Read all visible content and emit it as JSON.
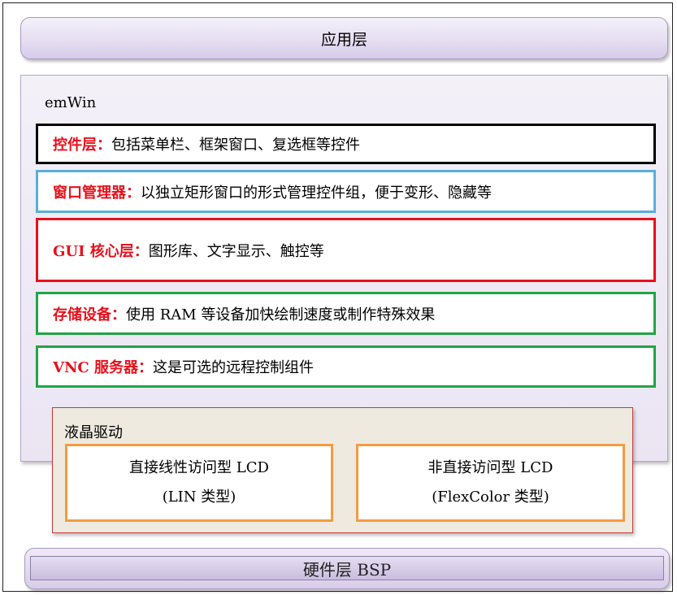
{
  "app_layer": {
    "label": "应用层"
  },
  "emwin": {
    "title": "emWin",
    "layers": [
      {
        "key": "控件层：",
        "desc": "包括菜单栏、框架窗口、复选框等控件"
      },
      {
        "key": "窗口管理器：",
        "desc": "以独立矩形窗口的形式管理控件组，便于变形、隐藏等"
      },
      {
        "key": "GUI 核心层：",
        "desc": "图形库、文字显示、触控等"
      },
      {
        "key": "存储设备：",
        "desc": "使用 RAM 等设备加快绘制速度或制作特殊效果"
      },
      {
        "key": "VNC 服务器：",
        "desc": "这是可选的远程控制组件"
      }
    ]
  },
  "lcd_driver": {
    "title": "液晶驱动",
    "direct": {
      "line1": "直接线性访问型 LCD",
      "line2": "(LIN 类型)"
    },
    "indirect": {
      "line1": "非直接访问型 LCD",
      "line2": "(FlexColor 类型)"
    }
  },
  "hardware_layer": {
    "label": "硬件层 BSP"
  },
  "colors": {
    "key_text": "#e8101b",
    "border_controls": "#000000",
    "border_window_manager": "#5aaedb",
    "border_gui_core": "#e8101b",
    "border_memory_devices": "#21a445",
    "border_vnc": "#21a445",
    "border_lcd_boxes": "#f49b3f",
    "lcd_background": "#eeeae0",
    "layer_purple": "#e6def2"
  }
}
